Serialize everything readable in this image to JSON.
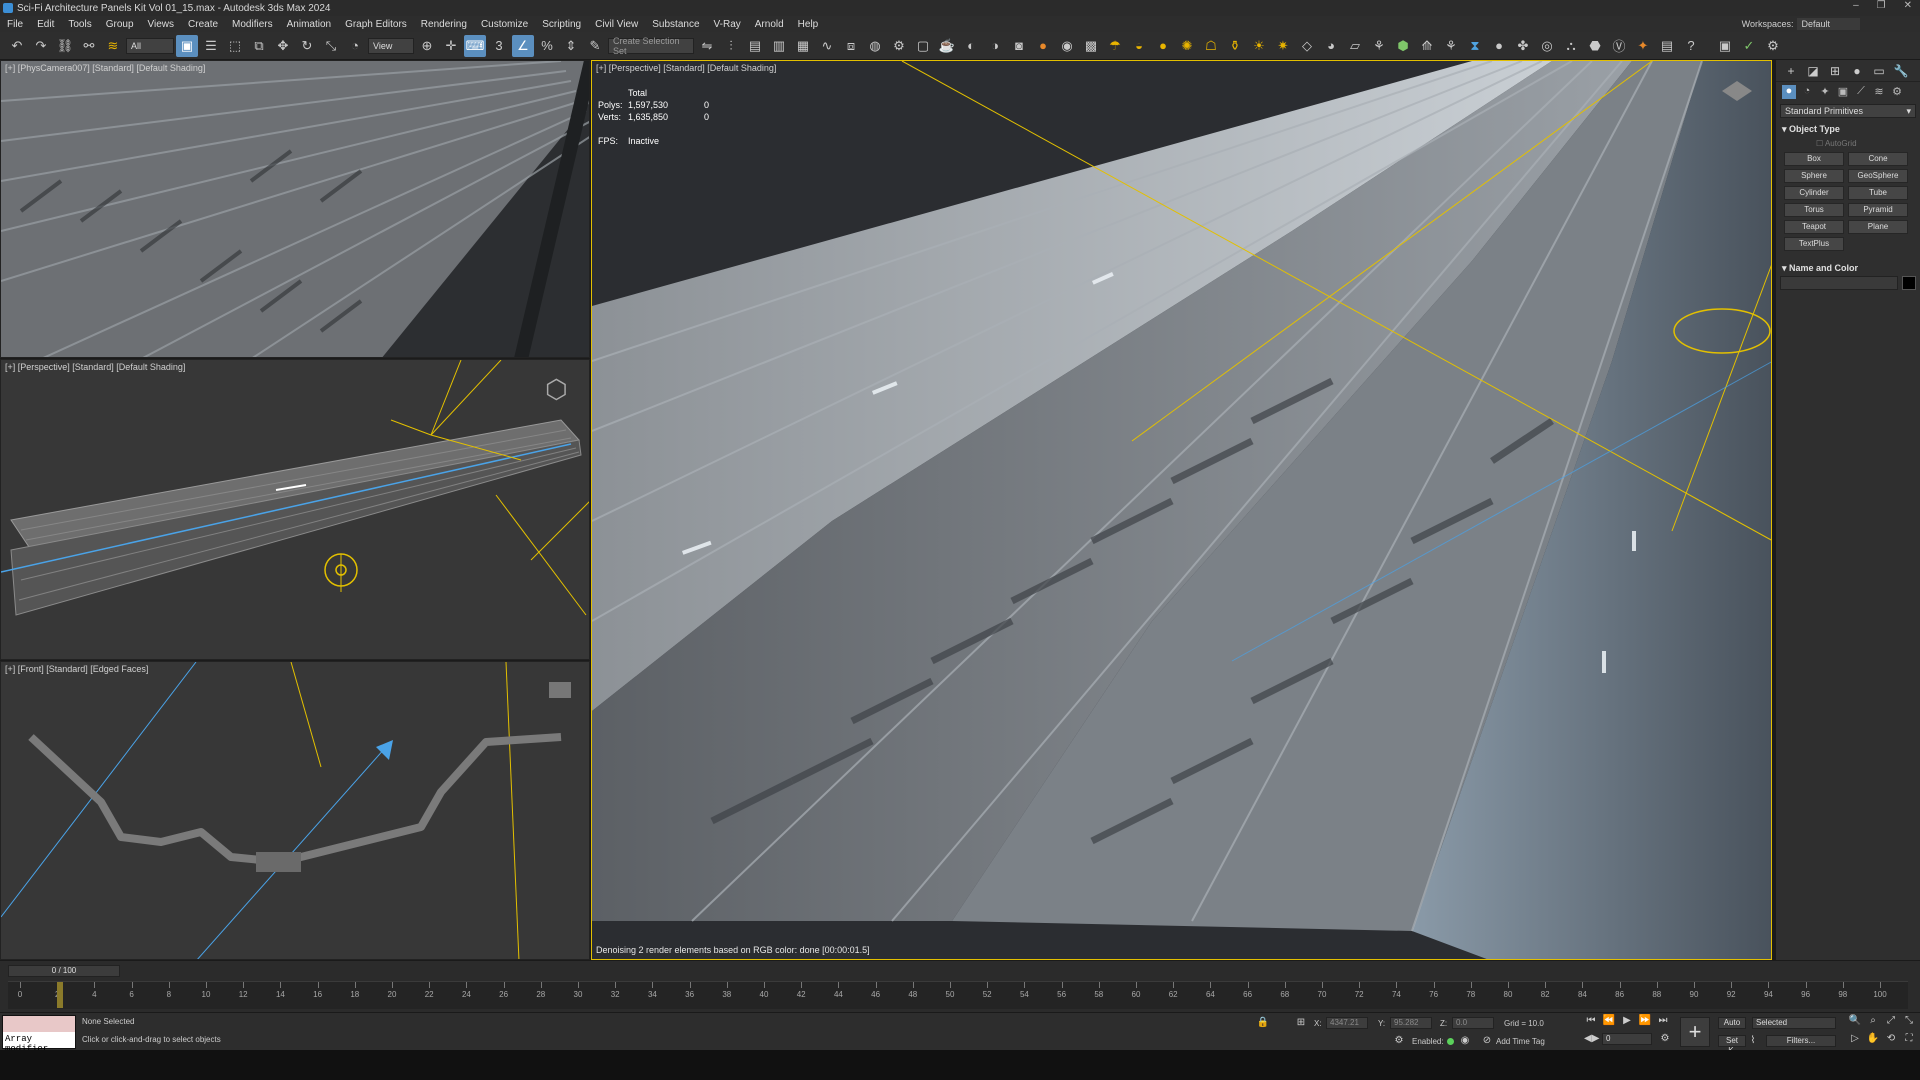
{
  "window": {
    "title": "Sci-Fi Architecture Panels Kit Vol 01_15.max - Autodesk 3ds Max 2024"
  },
  "menu": [
    "File",
    "Edit",
    "Tools",
    "Group",
    "Views",
    "Create",
    "Modifiers",
    "Animation",
    "Graph Editors",
    "Rendering",
    "Customize",
    "Scripting",
    "Civil View",
    "Substance",
    "V-Ray",
    "Arnold",
    "Help"
  ],
  "workspace": {
    "label": "Workspaces:",
    "value": "Default"
  },
  "toolbar": {
    "filter_value": "All",
    "refcoord_value": "View",
    "selection_set_placeholder": "Create Selection Set",
    "snap_label": "3",
    "icons": [
      "undo-icon",
      "redo-icon",
      "link-icon",
      "unlink-icon",
      "bind-space-warp-icon",
      "select-object-icon",
      "select-by-name-icon",
      "rect-region-icon",
      "window-crossing-icon",
      "move-icon",
      "rotate-icon",
      "scale-icon",
      "pivot-icon",
      "select-manipulate-icon",
      "snap-toggle-icon",
      "angle-snap-icon",
      "percent-snap-icon",
      "spinner-snap-icon",
      "edit-named-sel-icon",
      "mirror-icon",
      "align-icon",
      "toggle-scene-explorer-icon",
      "layer-explorer-icon",
      "ribbon-icon",
      "curve-editor-icon",
      "schematic-view-icon",
      "material-editor-icon",
      "render-setup-icon",
      "render-frame-icon",
      "render-icon",
      "vray-icon",
      "arnold-icon"
    ]
  },
  "viewports": {
    "top_left": {
      "label": "[+] [PhysCamera007] [Standard] [Default Shading]"
    },
    "mid_left": {
      "label": "[+] [Perspective] [Standard] [Default Shading]"
    },
    "bottom_left": {
      "label": "[+] [Front] [Standard] [Edged Faces]"
    },
    "main": {
      "label": "[+] [Perspective] [Standard] [Default Shading]",
      "stats": {
        "total_label": "Total",
        "polys_label": "Polys:",
        "polys_value": "1,597,530",
        "polys_sel": "0",
        "verts_label": "Verts:",
        "verts_value": "1,635,850",
        "verts_sel": "0",
        "fps_label": "FPS:",
        "fps_value": "Inactive"
      },
      "status": "Denoising 2 render elements based on RGB color: done [00:00:01.5]"
    }
  },
  "command_panel": {
    "category": "Standard Primitives",
    "object_type_title": "Object Type",
    "autogrid": "AutoGrid",
    "primitives": [
      "Box",
      "Cone",
      "Sphere",
      "GeoSphere",
      "Cylinder",
      "Tube",
      "Torus",
      "Pyramid",
      "Teapot",
      "Plane",
      "TextPlus"
    ],
    "name_color_title": "Name and Color"
  },
  "timeline": {
    "slider": "0 / 100",
    "ticks": [
      0,
      2,
      4,
      6,
      8,
      10,
      12,
      14,
      16,
      18,
      20,
      22,
      24,
      26,
      28,
      30,
      32,
      34,
      36,
      38,
      40,
      42,
      44,
      46,
      48,
      50,
      52,
      54,
      56,
      58,
      60,
      62,
      64,
      66,
      68,
      70,
      72,
      74,
      76,
      78,
      80,
      82,
      84,
      86,
      88,
      90,
      92,
      94,
      96,
      98,
      100
    ]
  },
  "statusbar": {
    "maxscript": "Array modifier",
    "selection": "None Selected",
    "prompt": "Click or click-and-drag to select objects",
    "x_label": "X:",
    "x_value": "4347.21",
    "y_label": "Y:",
    "y_value": "95.282",
    "z_label": "Z:",
    "z_value": "0.0",
    "grid": "Grid = 10.0",
    "enabled": "Enabled:",
    "add_time_tag": "Add Time Tag",
    "auto": "Auto",
    "setk": "Set K.",
    "selected": "Selected",
    "filters": "Filters...",
    "frame": "0"
  }
}
